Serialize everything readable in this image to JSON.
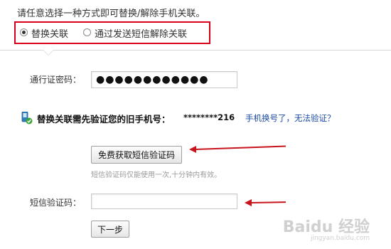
{
  "intro": "请任意选择一种方式即可替换/解除手机关联。",
  "options": [
    {
      "label": "替换关联",
      "checked": true
    },
    {
      "label": "通过发送短信解除关联",
      "checked": false
    }
  ],
  "password": {
    "label": "通行证密码：",
    "value": "●●●●●●●●●●●●"
  },
  "verify": {
    "title": "替换关联需先验证您的旧手机号：",
    "masked_number": "********216",
    "help_link": "手机换号了，无法验证？"
  },
  "sms": {
    "get_code_button": "免费获取短信验证码",
    "note": "短信验证码仅能使用一次,十分钟内有效。",
    "code_label": "短信验证码：",
    "code_value": ""
  },
  "next_button": "下一步",
  "watermark": {
    "logo": "Baidu 经验",
    "url": "jingyan.baidu.com"
  },
  "colors": {
    "highlight_box": "#d9001b",
    "arrow": "#c8141c",
    "link": "#1a4aa3"
  }
}
